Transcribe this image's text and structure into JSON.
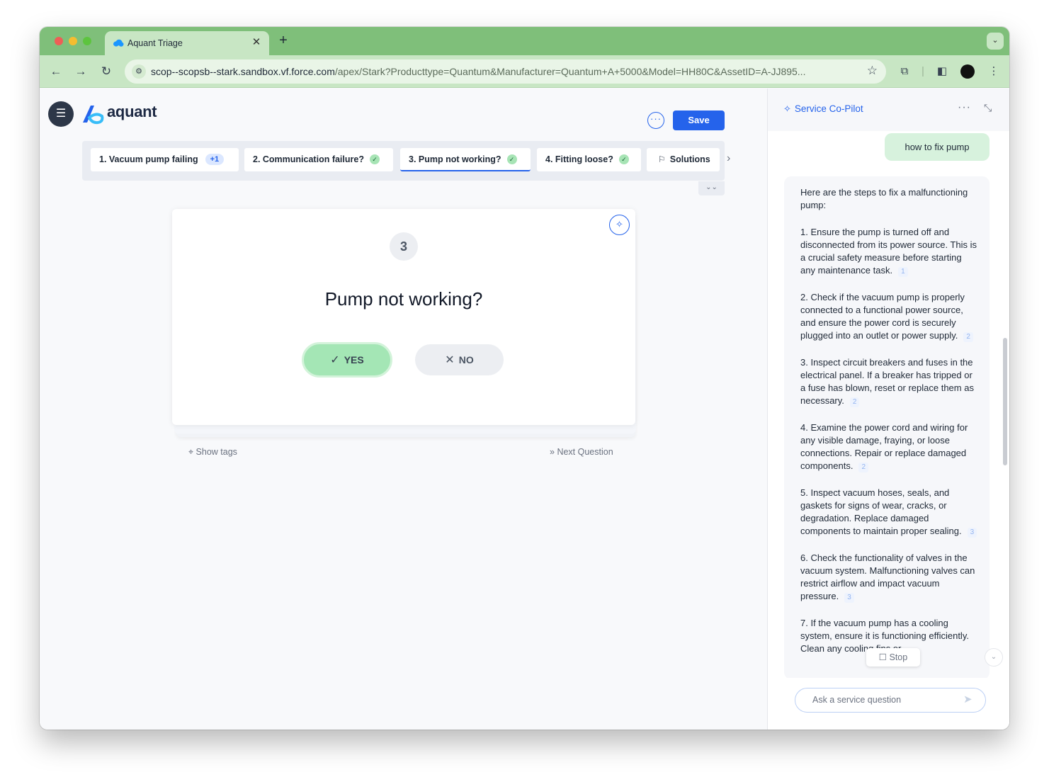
{
  "browser": {
    "tab_title": "Aquant Triage",
    "url_host": "scop--scopsb--stark.sandbox.vf.force.com",
    "url_path": "/apex/Stark?Producttype=Quantum&Manufacturer=Quantum+A+5000&Model=HH80C&AssetID=A-JJ895...",
    "new_tab": "+",
    "tab_close": "✕"
  },
  "header": {
    "logo_text": "aquant",
    "more_label": "···",
    "save_label": "Save"
  },
  "steps": [
    {
      "label": "1. Vacuum pump failing",
      "badge": "+1",
      "checked": false,
      "active": false
    },
    {
      "label": "2. Communication failure?",
      "checked": true,
      "active": false
    },
    {
      "label": "3. Pump not working?",
      "checked": true,
      "active": true
    },
    {
      "label": "4. Fitting loose?",
      "checked": true,
      "active": false
    },
    {
      "label": "Solutions",
      "checked": false,
      "active": false
    }
  ],
  "question": {
    "number": "3",
    "title": "Pump not working?",
    "yes_label": "YES",
    "no_label": "NO",
    "show_tags": "Show tags",
    "next_question": "Next Question"
  },
  "copilot": {
    "title": "Service Co-Pilot",
    "user_message": "how to fix pump",
    "intro": "Here are the steps to fix a malfunctioning pump:",
    "steps": [
      {
        "text": "1. Ensure the pump is turned off and disconnected from its power source. This is a crucial safety measure before starting any maintenance task.",
        "ref": "1"
      },
      {
        "text": "2. Check if the vacuum pump is properly connected to a functional power source, and ensure the power cord is securely plugged into an outlet or power supply.",
        "ref": "2"
      },
      {
        "text": "3. Inspect circuit breakers and fuses in the electrical panel. If a breaker has tripped or a fuse has blown, reset or replace them as necessary.",
        "ref": "2"
      },
      {
        "text": "4. Examine the power cord and wiring for any visible damage, fraying, or loose connections. Repair or replace damaged components.",
        "ref": "2"
      },
      {
        "text": "5. Inspect vacuum hoses, seals, and gaskets for signs of wear, cracks, or degradation. Replace damaged components to maintain proper sealing.",
        "ref": "3"
      },
      {
        "text": "6. Check the functionality of valves in the vacuum system. Malfunctioning valves can restrict airflow and impact vacuum pressure.",
        "ref": "3"
      },
      {
        "text": "7. If the vacuum pump has a cooling system, ensure it is functioning efficiently. Clean any cooling fins or",
        "ref": ""
      }
    ],
    "stop_label": "Stop",
    "input_placeholder": "Ask a service question"
  },
  "colors": {
    "accent": "#2563eb",
    "yes_green": "#a4e6b5",
    "user_bubble": "#d7f2dd",
    "chrome_green": "#7fbf7a"
  }
}
